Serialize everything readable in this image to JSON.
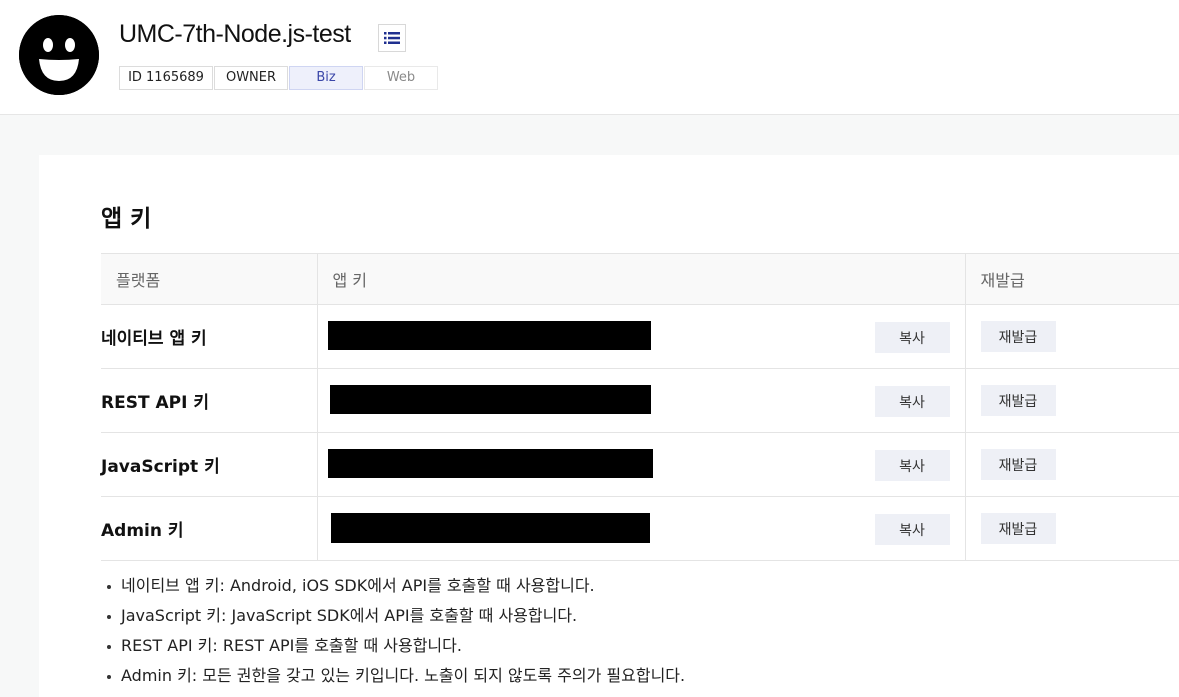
{
  "header": {
    "app_name": "UMC-7th-Node.js-test",
    "badges": {
      "id": "ID 1165689",
      "role": "OWNER",
      "biz": "Biz",
      "web": "Web"
    }
  },
  "section": {
    "title": "앱 키",
    "columns": [
      "플랫폼",
      "앱 키",
      "재발급"
    ],
    "rows": [
      {
        "platform": "네이티브 앱 키",
        "copy_label": "복사",
        "reissue_label": "재발급"
      },
      {
        "platform": "REST API 키",
        "copy_label": "복사",
        "reissue_label": "재발급"
      },
      {
        "platform": "JavaScript 키",
        "copy_label": "복사",
        "reissue_label": "재발급"
      },
      {
        "platform": "Admin 키",
        "copy_label": "복사",
        "reissue_label": "재발급"
      }
    ]
  },
  "notes": [
    "네이티브 앱 키: Android, iOS SDK에서 API를 호출할 때 사용합니다.",
    "JavaScript 키: JavaScript SDK에서 API를 호출할 때 사용합니다.",
    "REST API 키: REST API를 호출할 때 사용합니다.",
    "Admin 키: 모든 권한을 갖고 있는 키입니다. 노출이 되지 않도록 주의가 필요합니다."
  ],
  "icons": {
    "avatar": "smiley-face-icon",
    "menu": "list-icon"
  },
  "colors": {
    "biz_badge_bg": "#eef0fb",
    "biz_badge_text": "#3a46a8",
    "button_bg": "#eef0f6",
    "list_icon": "#1f2f8f"
  }
}
